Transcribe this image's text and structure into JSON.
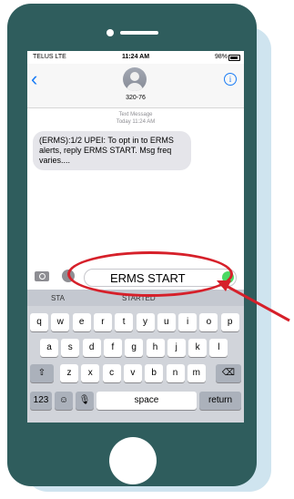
{
  "status_bar": {
    "carrier": "TELUS  LTE",
    "time": "11:24 AM",
    "battery": "98%"
  },
  "header": {
    "contact": "320-76"
  },
  "thread": {
    "meta_label": "Text Message",
    "meta_time": "Today 11:24 AM",
    "message": "(ERMS):1/2 UPEI: To opt in to ERMS alerts, reply ERMS START. Msg freq varies...."
  },
  "input": {
    "value": "ERMS START"
  },
  "keyboard": {
    "suggestions": [
      "STA",
      "STARTED"
    ],
    "row1": [
      "q",
      "w",
      "e",
      "r",
      "t",
      "y",
      "u",
      "i",
      "o",
      "p"
    ],
    "row2": [
      "a",
      "s",
      "d",
      "f",
      "g",
      "h",
      "j",
      "k",
      "l"
    ],
    "row3": [
      "z",
      "x",
      "c",
      "v",
      "b",
      "n",
      "m"
    ],
    "numbers_key": "123",
    "space_key": "space",
    "return_key": "return"
  },
  "colors": {
    "phone": "#2f5d5d",
    "annotation": "#d6202a",
    "ios_blue": "#1a7cf5"
  }
}
